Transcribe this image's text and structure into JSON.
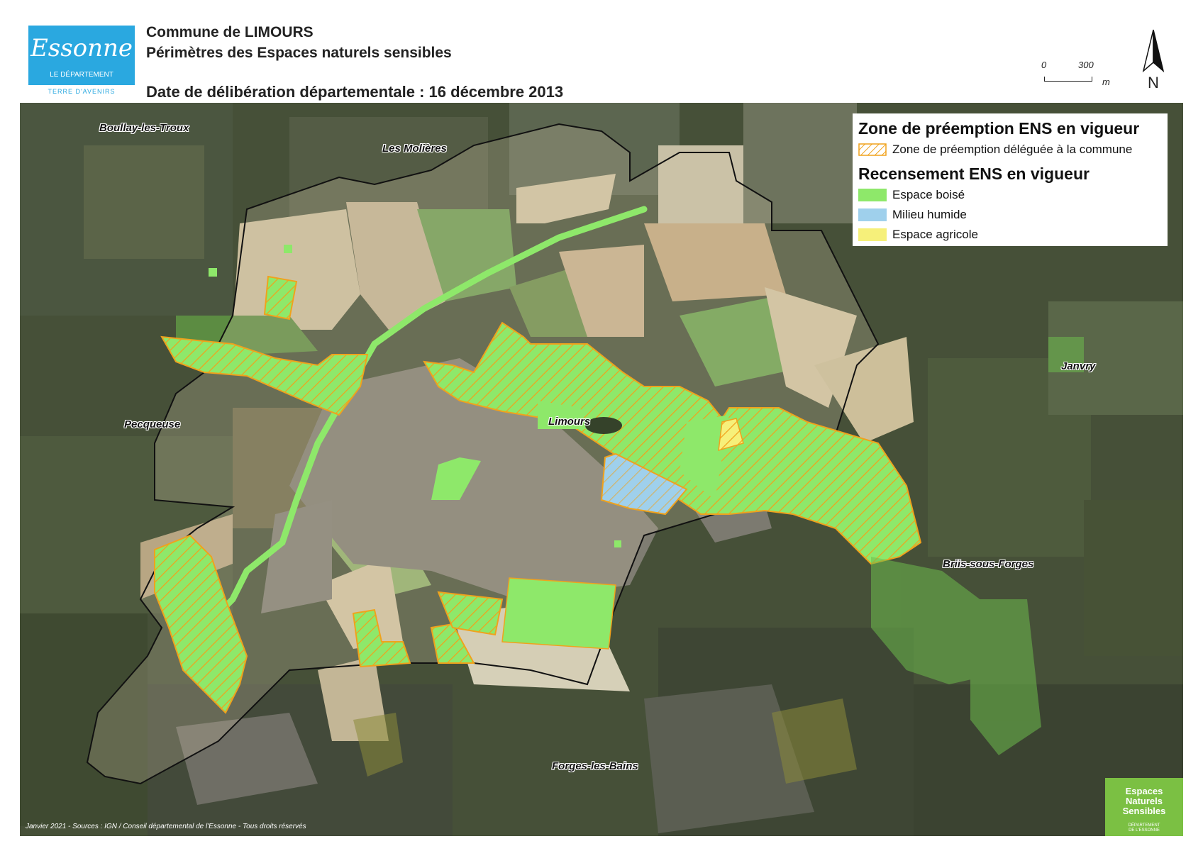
{
  "header": {
    "logo_script": "Essonne",
    "logo_sub": "LE DÉPARTEMENT",
    "logo_tagline": "TERRE D'AVENIRS",
    "title_line1": "Commune de LIMOURS",
    "title_line2": "Périmètres des Espaces naturels sensibles",
    "date_line": "Date de délibération départementale : 16 décembre 2013"
  },
  "scale_bar": {
    "start": "0",
    "end": "300",
    "unit": "m"
  },
  "north_arrow": {
    "label": "N",
    "icon": "north-arrow-icon"
  },
  "place_names": {
    "boullay": "Boullay-les-Troux",
    "molieres": "Les Molières",
    "pecqueuse": "Pecqueuse",
    "limours": "Limours",
    "janvry": "Janvry",
    "bris": "Briis-sous-Forges",
    "forges": "Forges-les-Bains"
  },
  "legend": {
    "section1_title": "Zone de préemption ENS en vigueur",
    "section1_items": [
      {
        "label": "Zone de préemption déléguée à la commune",
        "swatch": "hatch",
        "color": "#f0a21c"
      }
    ],
    "section2_title": "Recensement ENS en vigueur",
    "section2_items": [
      {
        "label": "Espace boisé",
        "color": "#8ee86a"
      },
      {
        "label": "Milieu humide",
        "color": "#9fd0ec"
      },
      {
        "label": "Espace agricole",
        "color": "#f6f07a"
      }
    ]
  },
  "credits": "Janvier 2021 - Sources : IGN / Conseil départemental de l'Essonne - Tous droits réservés",
  "ens_logo": {
    "line1": "Espaces",
    "line2": "Naturels",
    "line3": "Sensibles",
    "sub1": "DÉPARTEMENT",
    "sub2": "DE L'ESSONNE"
  },
  "colors": {
    "woodland": "#8ee86a",
    "wetland": "#9fd0ec",
    "agricultural": "#f6f07a",
    "preemption_hatch": "#f0a21c",
    "commune_border": "#111111"
  }
}
